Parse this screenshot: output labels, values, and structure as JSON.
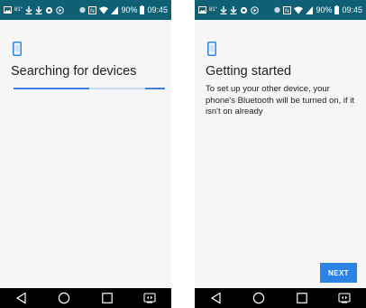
{
  "status_bar": {
    "time": "09:45",
    "battery_percent": "90%"
  },
  "left_screen": {
    "title": "Searching for devices",
    "progress": {
      "indeterminate": true,
      "segments": [
        0.5,
        0.13
      ]
    }
  },
  "right_screen": {
    "title": "Getting started",
    "description": "To set up your other device, your phone's Bluetooth will be turned on, if it isn't on already",
    "next_label": "NEXT"
  },
  "colors": {
    "status_bar": "#0f5f75",
    "accent": "#2c83e6",
    "progress_track": "#c9ddf8",
    "progress_bar": "#3f7fde",
    "nav_bar": "#000000"
  },
  "icons": [
    "gallery-icon",
    "temperature-icon",
    "download-icon",
    "download-icon",
    "circle-icon",
    "play-icon",
    "bluetooth-icon",
    "nfc-icon",
    "wifi-icon",
    "signal-icon",
    "battery-icon",
    "back-icon",
    "home-icon",
    "recents-icon",
    "screen-mirror-icon",
    "phone-icon"
  ]
}
